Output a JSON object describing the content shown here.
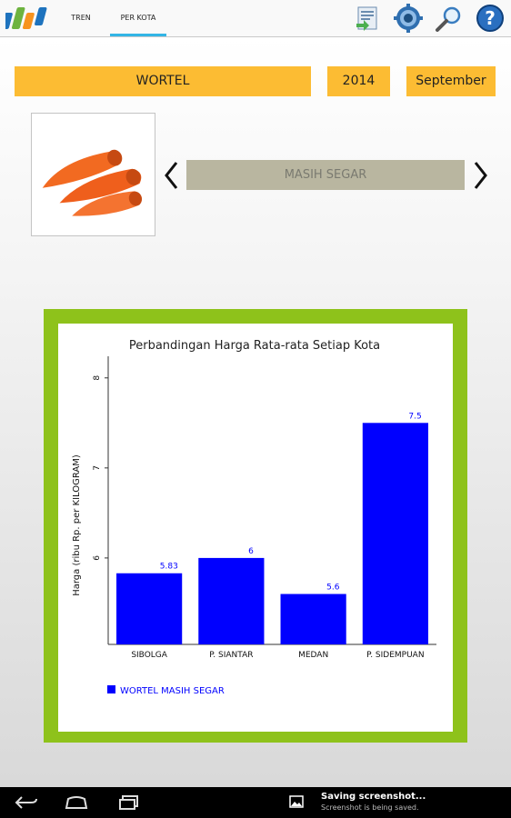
{
  "tabs": [
    {
      "label": "TREN",
      "selected": false
    },
    {
      "label": "PER KOTA",
      "selected": true
    }
  ],
  "toolbar_icons": [
    "report-icon",
    "settings-gear-icon",
    "search-icon",
    "help-icon"
  ],
  "selectors": {
    "commodity": "WORTEL",
    "year": "2014",
    "month": "September"
  },
  "product": {
    "image_icon": "carrot-icon",
    "status": "MASIH SEGAR"
  },
  "chart_data": {
    "type": "bar",
    "title": "Perbandingan Harga Rata-rata Setiap Kota",
    "ylabel": "Harga (ribu Rp. per KILOGRAM)",
    "xlabel": "",
    "categories": [
      "SIBOLGA",
      "P. SIANTAR",
      "MEDAN",
      "P. SIDEMPUAN"
    ],
    "series": [
      {
        "name": "WORTEL MASIH SEGAR",
        "values": [
          5.83,
          6,
          5.6,
          7.5
        ],
        "labels": [
          "5.83",
          "6",
          "5.6",
          "7.5"
        ],
        "color": "#0000ff"
      }
    ],
    "ylim": [
      5.04,
      8.24
    ],
    "yticks": [
      6,
      7,
      8
    ],
    "legend_position": "bottom-left",
    "grid": false
  },
  "colors": {
    "accent": "#fcbc33",
    "frame": "#8ec21b",
    "status_bg": "#b9b6a0",
    "bar": "#0000ff",
    "tab_indicator": "#33b5e5"
  },
  "notification": {
    "title": "Saving screenshot...",
    "subtitle": "Screenshot is being saved.",
    "icon": "image-icon"
  },
  "nav_icons": [
    "back-icon",
    "home-icon",
    "recent-apps-icon"
  ]
}
